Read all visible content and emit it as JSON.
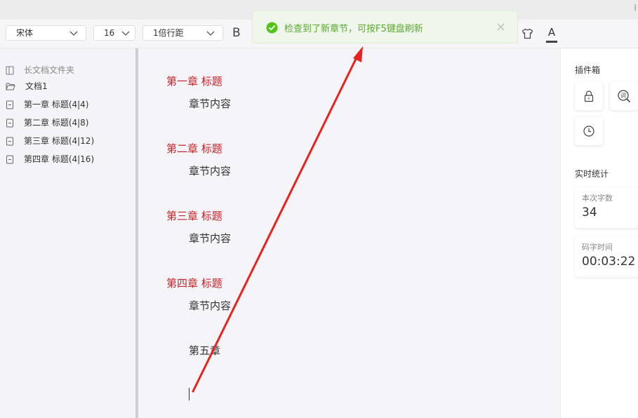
{
  "toolbar": {
    "font_family": "宋体",
    "font_size": "16",
    "line_spacing": "1倍行距",
    "bold_label": "B",
    "font_color_label": "A"
  },
  "sidebar": {
    "folder_label": "长文档文件夹",
    "doc_label": "文档1",
    "chapters": [
      {
        "label": "第一章 标题(4|4)"
      },
      {
        "label": "第二章 标题(4|8)"
      },
      {
        "label": "第三章 标题(4|12)"
      },
      {
        "label": "第四章 标题(4|16)"
      }
    ]
  },
  "editor": {
    "blocks": [
      {
        "heading": "第一章 标题",
        "body": "章节内容"
      },
      {
        "heading": "第二章 标题",
        "body": "章节内容"
      },
      {
        "heading": "第三章 标题",
        "body": "章节内容"
      },
      {
        "heading": "第四章 标题",
        "body": "章节内容"
      }
    ],
    "extra_line": "第五章"
  },
  "right_panel": {
    "plugins_title": "插件箱",
    "plugin_icons": [
      "lock-icon",
      "dictionary-search-icon",
      "clock-icon"
    ],
    "dict_glyph": "词",
    "stats_title": "实时统计",
    "word_count_label": "本次字数",
    "word_count_value": "34",
    "typing_time_label": "码字时间",
    "typing_time_value": "00:03:22"
  },
  "toast": {
    "message": "检查到了新章节，可按F5键盘刷新"
  },
  "colors": {
    "heading": "#c4262b",
    "toast_text": "#5aa832",
    "toast_bg": "#eff7ea",
    "arrow": "#e8231f"
  }
}
